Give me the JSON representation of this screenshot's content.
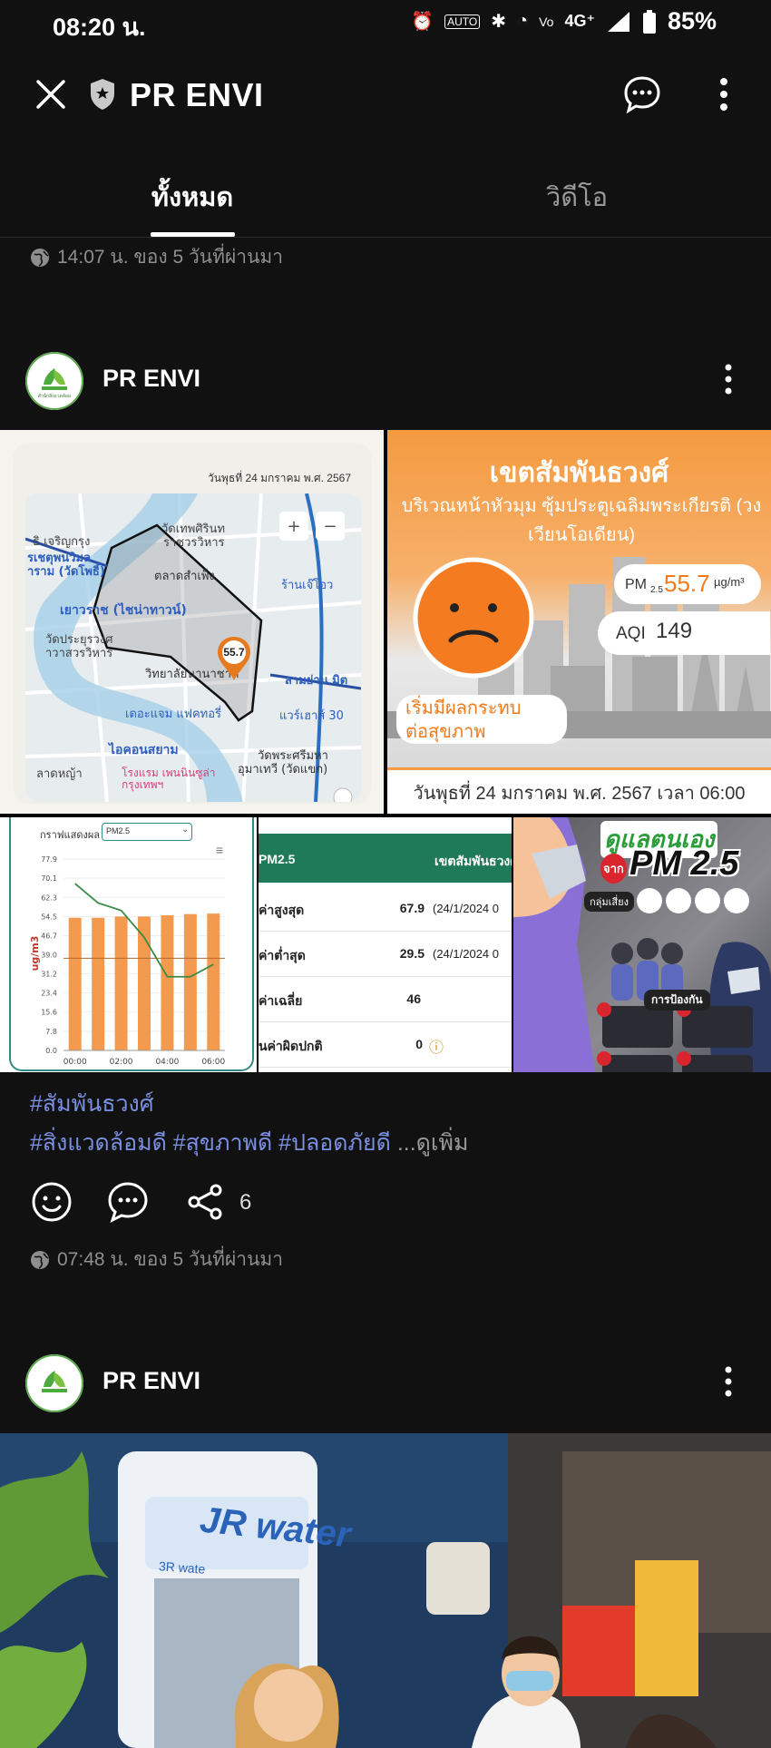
{
  "status": {
    "time": "08:20 น.",
    "network": "4G⁺",
    "battery": "85%"
  },
  "app": {
    "title": "PR ENVI"
  },
  "tabs": [
    {
      "label": "ทั้งหมด"
    },
    {
      "label": "วิดีโอ"
    }
  ],
  "prev_post": {
    "timestamp": "14:07 น. ของ 5 วันที่ผ่านมา"
  },
  "post": {
    "author": "PR ENVI",
    "map_tile": {
      "date": "วันพุธที่ 24 มกราคม พ.ศ. 2567",
      "marker_value": "55.7",
      "labels": [
        "วัดเทพศิรินท",
        "ธิ เจริญกรุง",
        "ราชวรวิหาร",
        "รเชตุพนวิมล",
        "าราม (วัดโพธิ์)",
        "ตลาดสำเพ็ง",
        "ร้านเจ๊โอว",
        "เยาวราช (ไชน่าทาวน์)",
        "วัดประยุรวงศ",
        "าวาสวรวิหาร",
        "วิทยาลัยนานาชาติ",
        "สามย่าน มิต",
        "เดอะแจม แฟคทอรี่",
        "แวร์เฮาส์ 30",
        "ไอคอนสยาม",
        "วัดพระศรีมหา",
        "อุมาเทวี (วัดแขก)",
        "โรงแรม เพนนินซูล่า กรุงเทพฯ",
        "ลาดหญ้า"
      ]
    },
    "aqi_card": {
      "district": "เขตสัมพันธวงศ์",
      "location": "บริเวณหน้าหัวมุม ซุ้มประตูเฉลิมพระเกียรติ (วงเวียนโอเดียน)",
      "pm_label": "PM",
      "pm_sub": "2.5",
      "pm_value": "55.7",
      "pm_unit": "µg/m³",
      "aqi_label": "AQI",
      "aqi_value": "149",
      "health_text": "เริ่มมีผลกระทบต่อสุขภาพ",
      "datetime": "วันพุธที่ 24 มกราคม พ.ศ. 2567 เวลา 06:00"
    },
    "table_tile": {
      "header_left": "PM2.5",
      "header_right": "เขตสัมพันธวงศ์",
      "rows": [
        {
          "label": "ค่าสูงสุด",
          "value": "67.9",
          "note": "(24/1/2024 0"
        },
        {
          "label": "ค่าต่ำสุด",
          "value": "29.5",
          "note": "(24/1/2024 0"
        },
        {
          "label": "ค่าเฉลี่ย",
          "value": "46",
          "note": ""
        },
        {
          "label": "นค่าผิดปกติ",
          "value": "0",
          "note": "ⓘ"
        }
      ]
    },
    "poster_tile": {
      "title_line1": "ดูแลตนเอง",
      "title_from": "จาก",
      "title_pm": "PM 2.5",
      "risk_group": "กลุ่มเสี่ยง",
      "protect": "การป้องกัน"
    },
    "hashtags_line1": "#สัมพันธวงศ์",
    "hashtags_line2": "#สิ่งแวดล้อมดี #สุขภาพดี #ปลอดภัยดี",
    "see_more": "...ดูเพิ่ม",
    "share_count": "6",
    "timestamp": "07:48 น. ของ 5 วันที่ผ่านมา"
  },
  "post2": {
    "author": "PR ENVI",
    "photo_sign": "JR water",
    "photo_sign_small": "3R wate"
  },
  "chart_data": {
    "type": "bar",
    "title": "กราฟแสดงผล",
    "selector": "PM2.5",
    "ylabel": "ug/m3",
    "yticks": [
      "77.9",
      "70.1",
      "62.3",
      "54.5",
      "46.7",
      "39.0",
      "31.2",
      "23.4",
      "15.6",
      "7.8",
      "0.0"
    ],
    "xticks": [
      "00:00",
      "02:00",
      "04:00",
      "06:00"
    ],
    "categories": [
      "00:00",
      "01:00",
      "02:00",
      "03:00",
      "04:00",
      "05:00",
      "06:00"
    ],
    "ylim": [
      0,
      77.9
    ],
    "series": [
      {
        "type": "bar",
        "values": [
          54,
          54,
          54.5,
          54.5,
          55,
          55.5,
          55.7
        ]
      },
      {
        "type": "line",
        "values": [
          67.9,
          60,
          57,
          46,
          30,
          30,
          35
        ]
      }
    ],
    "colors": {
      "bar": "#f39a4e",
      "line": "#3b8a45",
      "ref_line": "#b86a2a"
    }
  }
}
